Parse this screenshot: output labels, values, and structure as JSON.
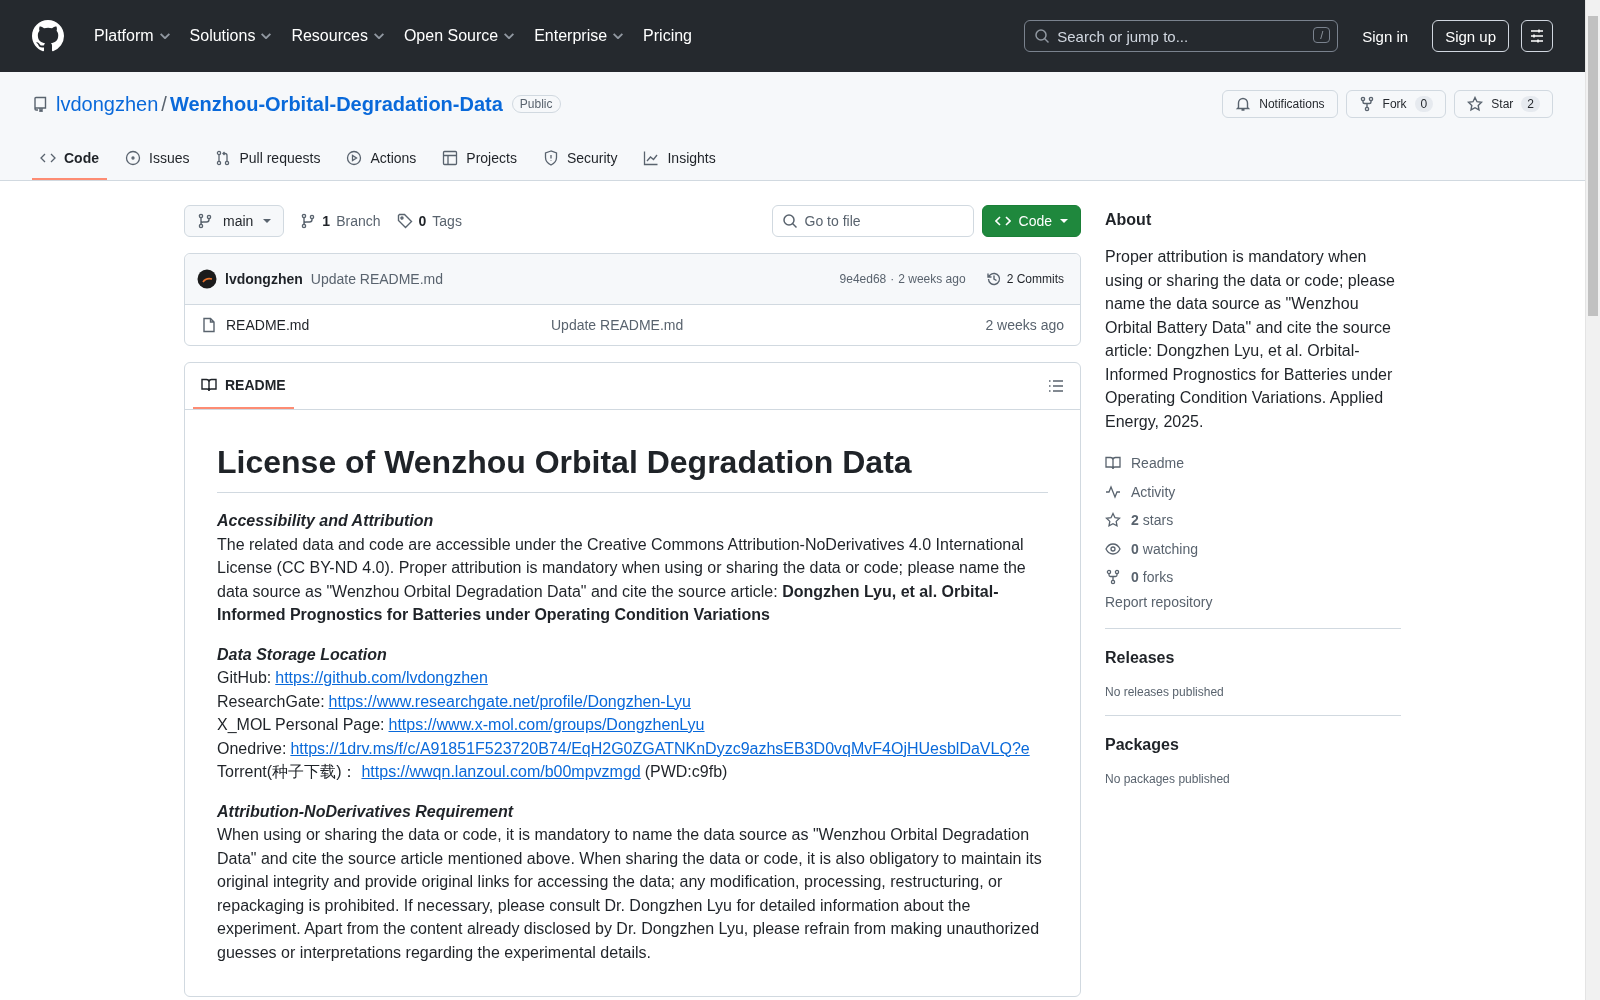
{
  "header": {
    "nav": [
      {
        "label": "Platform",
        "dropdown": true
      },
      {
        "label": "Solutions",
        "dropdown": true
      },
      {
        "label": "Resources",
        "dropdown": true
      },
      {
        "label": "Open Source",
        "dropdown": true
      },
      {
        "label": "Enterprise",
        "dropdown": true
      },
      {
        "label": "Pricing",
        "dropdown": false
      }
    ],
    "search": {
      "placeholder": "Search or jump to...",
      "shortcut": "/"
    },
    "sign_in": "Sign in",
    "sign_up": "Sign up"
  },
  "repo": {
    "owner": "lvdongzhen",
    "separator": "/",
    "name": "Wenzhou-Orbital-Degradation-Data",
    "visibility": "Public",
    "notifications": "Notifications",
    "fork": {
      "label": "Fork",
      "count": "0"
    },
    "star": {
      "label": "Star",
      "count": "2"
    }
  },
  "tabs": [
    {
      "label": "Code",
      "kind": "code",
      "selected": true
    },
    {
      "label": "Issues",
      "kind": "issue",
      "selected": false
    },
    {
      "label": "Pull requests",
      "kind": "pr",
      "selected": false
    },
    {
      "label": "Actions",
      "kind": "play",
      "selected": false
    },
    {
      "label": "Projects",
      "kind": "table",
      "selected": false
    },
    {
      "label": "Security",
      "kind": "shield",
      "selected": false
    },
    {
      "label": "Insights",
      "kind": "graph",
      "selected": false
    }
  ],
  "toolbar": {
    "branch": "main",
    "branches": {
      "count": "1",
      "label": "Branch"
    },
    "tags": {
      "count": "0",
      "label": "Tags"
    },
    "go_to_file": {
      "placeholder": "Go to file"
    },
    "code_button": "Code"
  },
  "commit": {
    "author": "lvdongzhen",
    "message": "Update README.md",
    "hash": "9e4ed68",
    "separator": "·",
    "time": "2 weeks ago",
    "commits": "2 Commits"
  },
  "files": [
    {
      "name": "README.md",
      "message": "Update README.md",
      "time": "2 weeks ago"
    }
  ],
  "readme": {
    "tab": "README",
    "title": "License of Wenzhou Orbital Degradation Data",
    "sections": [
      {
        "kind": "text",
        "heading": "Accessibility and Attribution",
        "body": "The related data and code are accessible under the Creative Commons Attribution-NoDerivatives 4.0 International License (CC BY-ND 4.0). Proper attribution is mandatory when using or sharing the data or code; please name the data source as \"Wenzhou Orbital Degradation Data\" and cite the source article: **Dongzhen Lyu, et al. Orbital-Informed Prognostics for Batteries under Operating Condition Variations**"
      },
      {
        "kind": "links",
        "heading": "Data Storage Location",
        "lines": [
          {
            "label": "GitHub:",
            "link": "https://github.com/lvdongzhen"
          },
          {
            "label": "ResearchGate:",
            "link": "https://www.researchgate.net/profile/Dongzhen-Lyu"
          },
          {
            "label": "X_MOL Personal Page:",
            "link": "https://www.x-mol.com/groups/DongzhenLyu"
          },
          {
            "label": "Onedrive:",
            "link": "https://1drv.ms/f/c/A91851F523720B74/EqH2G0ZGATNKnDyzc9azhsEB3D0vqMvF4OjHUesblDaVLQ?e"
          },
          {
            "label": "Torrent(种子下载)：",
            "link": "https://wwqn.lanzoul.com/b00mpvzmgd",
            "suffix": "(PWD:c9fb)"
          }
        ]
      },
      {
        "kind": "text",
        "heading": "Attribution-NoDerivatives Requirement",
        "body": "When using or sharing the data or code, it is mandatory to name the data source as \"Wenzhou Orbital Degradation Data\" and cite the source article mentioned above. When sharing the data or code, it is also obligatory to maintain its original integrity and provide original links for accessing the data; any modification, processing, restructuring, or repackaging is prohibited. If necessary, please consult Dr. Dongzhen Lyu for detailed information about the experiment. Apart from the content already disclosed by Dr. Dongzhen Lyu, please refrain from making unauthorized guesses or interpretations regarding the experimental details."
      }
    ]
  },
  "sidebar": {
    "about": {
      "heading": "About",
      "description": "Proper attribution is mandatory when using or sharing the data or code; please name the data source as \"Wenzhou Orbital Battery Data\" and cite the source article: Dongzhen Lyu, et al. Orbital-Informed Prognostics for Batteries under Operating Condition Variations. Applied Energy, 2025.",
      "links": [
        {
          "kind": "book",
          "label": "Readme"
        },
        {
          "kind": "pulse",
          "label": "Activity"
        },
        {
          "kind": "star",
          "count": "2",
          "label": "stars"
        },
        {
          "kind": "eye",
          "count": "0",
          "label": "watching"
        },
        {
          "kind": "fork",
          "count": "0",
          "label": "forks"
        }
      ],
      "report": "Report repository"
    },
    "releases": {
      "heading": "Releases",
      "note": "No releases published"
    },
    "packages": {
      "heading": "Packages",
      "note": "No packages published"
    }
  }
}
